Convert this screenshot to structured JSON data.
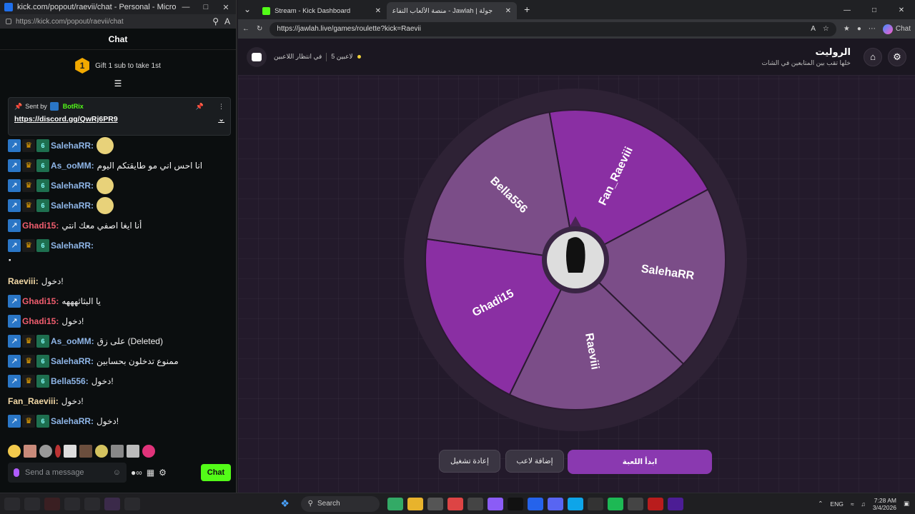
{
  "kick": {
    "window_title": "kick.com/popout/raevii/chat - Personal - Microsoft...",
    "url": "https://kick.com/popout/raevii/chat",
    "chat_header": "Chat",
    "gift_rank": "1",
    "gift_text": "Gift 1 sub to take 1st",
    "pinned": {
      "sent_by": "Sent by",
      "bot_name": "BotRix",
      "link": "https://discord.gg/QwRj6PR9"
    },
    "messages": [
      {
        "user": "SalehaRR:",
        "text": "",
        "emote": true
      },
      {
        "user": "As_ooMM:",
        "text": "انا احس اني مو طايقتكم اليوم"
      },
      {
        "user": "SalehaRR:",
        "text": "",
        "emote": true
      },
      {
        "user": "SalehaRR:",
        "text": "",
        "emote": true
      },
      {
        "user": "Ghadi15:",
        "text": "أنا ايغا اصفي معك انتي"
      },
      {
        "user": "SalehaRR:",
        "text": ""
      },
      {
        "long": "ٔٔٔٔٔٔٔٔٔٔٔٔٔٔٔٔٔٔٔٔٔٔٔٔٔٔٔٔٔٔٔٔٔٔٔٔٔٔٔٔٔٔٔٔٔٔٔٔٔٔٔٔٔٔٔٔٔٔٔٔٔٔٔٔٔٔٔ"
      },
      {
        "user": "Raeviii:",
        "text": "دخول!"
      },
      {
        "user": "Ghadi15:",
        "text": "يا البثاثهههه"
      },
      {
        "user": "Ghadi15:",
        "text": "دخول!"
      },
      {
        "user": "As_ooMM:",
        "text": "على زق (Deleted)"
      },
      {
        "user": "SalehaRR:",
        "text": "ممنوع تدخلون بحسابين"
      },
      {
        "user": "Bella556:",
        "text": "دخول!"
      },
      {
        "user": "Fan_Raeviii:",
        "text": "دخول!"
      },
      {
        "user": "SalehaRR:",
        "text": "دخول!"
      }
    ],
    "input_placeholder": "Send a message",
    "send_label": "Chat"
  },
  "jawlah": {
    "tabs": [
      {
        "label": "Stream - Kick Dashboard"
      },
      {
        "label": "جولة | Jawlah - منصة الألعاب التفاعلية"
      }
    ],
    "url": "https://jawlah.live/games/roulette?kick=Raevii",
    "copilot_label": "Chat",
    "status": {
      "players": "5 لاعبين",
      "waiting": "في انتظار اللاعبين"
    },
    "title": "الروليت",
    "subtitle": "خلها تقب بين المتابعين في الشات",
    "wheel": {
      "segments": [
        "Fan_Raeviii",
        "SalehaRR",
        "Raeviii",
        "Ghadi15",
        "Bella556"
      ],
      "colors": [
        "#8a2fa3",
        "#7b4d88",
        "#7b4d88",
        "#8a2fa3",
        "#7b4d88"
      ]
    },
    "buttons": {
      "restart": "إعادة تشغيل",
      "add_player": "إضافة لاعب",
      "start": "ابدأ اللعبة"
    }
  },
  "taskbar": {
    "search": "Search",
    "lang": "ENG",
    "time": "7:28 AM",
    "date": "3/4/2026"
  }
}
